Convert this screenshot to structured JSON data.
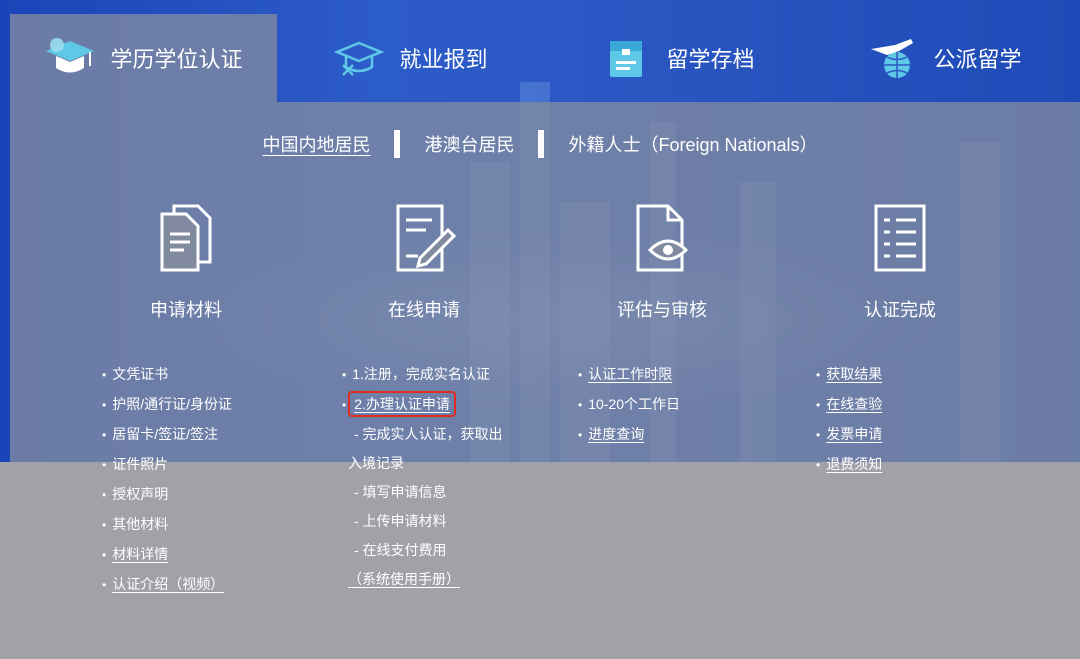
{
  "tabs": [
    {
      "label": "学历学位认证",
      "icon": "graduation-cap-icon",
      "active": true
    },
    {
      "label": "就业报到",
      "icon": "employment-cap-icon",
      "active": false
    },
    {
      "label": "留学存档",
      "icon": "archive-folder-icon",
      "active": false
    },
    {
      "label": "公派留学",
      "icon": "airplane-globe-icon",
      "active": false
    }
  ],
  "subnav": {
    "mainland": "中国内地居民",
    "hmt": "港澳台居民",
    "foreign": "外籍人士（Foreign Nationals）"
  },
  "steps": [
    {
      "label": "申请材料",
      "icon": "documents-icon"
    },
    {
      "label": "在线申请",
      "icon": "form-edit-icon"
    },
    {
      "label": "评估与审核",
      "icon": "review-eye-icon"
    },
    {
      "label": "认证完成",
      "icon": "checklist-icon"
    }
  ],
  "materials": {
    "items": [
      "文凭证书",
      "护照/通行证/身份证",
      "居留卡/签证/签注",
      "证件照片",
      "授权声明",
      "其他材料"
    ],
    "details_link": "材料详情",
    "video_link": "认证介绍（视频）"
  },
  "apply": {
    "step1": "1.注册，完成实名认证",
    "step2": "2.办理认证申请",
    "sub1a": "- 完成实人认证，获取出",
    "sub1b": "入境记录",
    "sub2": "- 填写申请信息",
    "sub3": "- 上传申请材料",
    "sub4": "- 在线支付费用",
    "manual_link": "（系统使用手册）"
  },
  "review": {
    "time_limit_link": "认证工作时限",
    "days": "10-20个工作日",
    "progress_link": "进度查询"
  },
  "complete": {
    "result_link": "获取结果",
    "verify_link": "在线查验",
    "invoice_link": "发票申请",
    "refund_link": "退费须知"
  },
  "colors": {
    "bg_blue": "#2a56c2",
    "overlay": "#828aa0",
    "highlight": "#e02b20"
  }
}
